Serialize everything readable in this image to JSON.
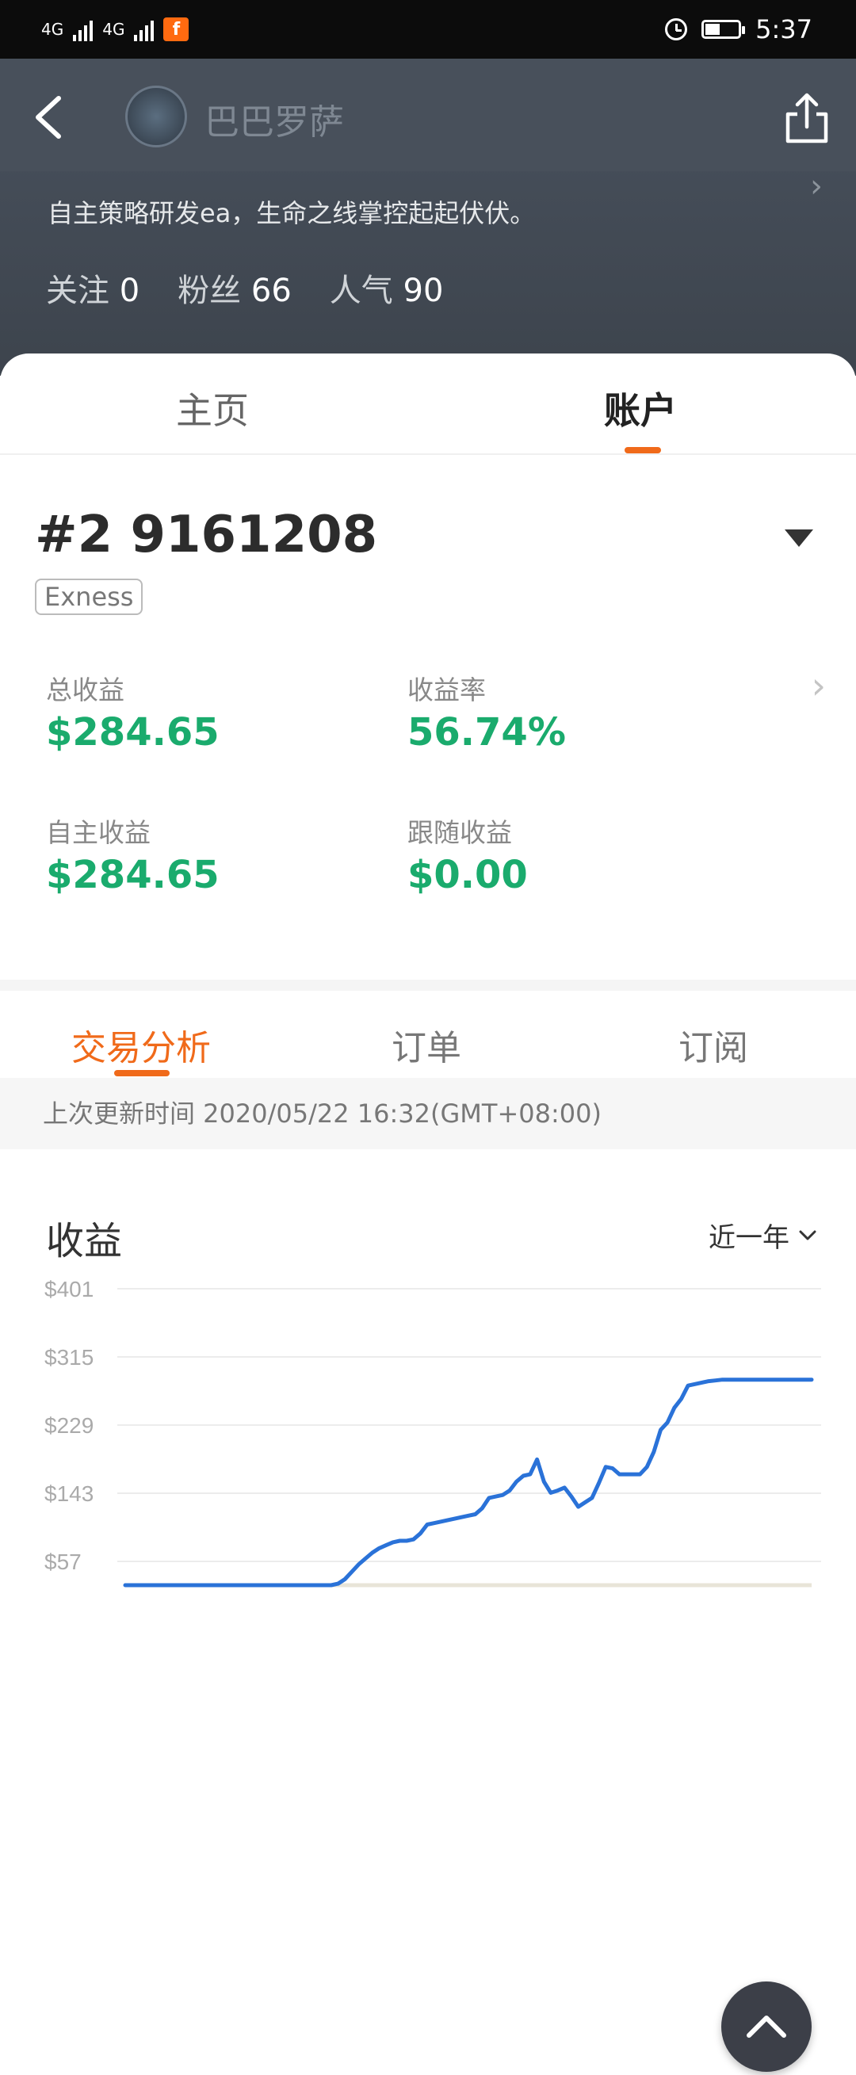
{
  "status_bar": {
    "network_1": "4G",
    "network_2": "4G",
    "time": "5:37"
  },
  "header": {
    "username": "巴巴罗萨",
    "bio": "自主策略研发ea，生命之线掌控起起伏伏。",
    "stats": [
      {
        "label": "关注",
        "value": "0"
      },
      {
        "label": "粉丝",
        "value": "66"
      },
      {
        "label": "人气",
        "value": "90"
      }
    ]
  },
  "tabs": {
    "home": "主页",
    "account": "账户"
  },
  "account": {
    "number": "#2 9161208",
    "broker": "Exness",
    "metrics": [
      {
        "label": "总收益",
        "value": "$284.65"
      },
      {
        "label": "收益率",
        "value": "56.74%"
      },
      {
        "label": "自主收益",
        "value": "$284.65"
      },
      {
        "label": "跟随收益",
        "value": "$0.00"
      }
    ]
  },
  "sub_tabs": {
    "analysis": "交易分析",
    "orders": "订单",
    "subscriptions": "订阅"
  },
  "update_time": "上次更新时间 2020/05/22 16:32(GMT+08:00)",
  "section": {
    "title": "收益",
    "range": "近一年"
  },
  "colors": {
    "accent": "#f06a1a",
    "positive": "#1aab6d",
    "line": "#2a72d8"
  },
  "chart_data": {
    "type": "line",
    "title": "",
    "xlabel": "",
    "ylabel": "",
    "y_ticks": [
      "$401",
      "$315",
      "$229",
      "$143",
      "$57"
    ],
    "ylim": [
      0,
      401
    ],
    "x": [
      0,
      1,
      2,
      3,
      4,
      5,
      6,
      7,
      8,
      9,
      10,
      11,
      12,
      13,
      14,
      15,
      16,
      17,
      18,
      19,
      20,
      21,
      22,
      23,
      24,
      25,
      26,
      27,
      28,
      29,
      30,
      31,
      32,
      33,
      34,
      35,
      36,
      37,
      38,
      39,
      40,
      41,
      42,
      43,
      44,
      45,
      46,
      47,
      48,
      49,
      50,
      51,
      52,
      53,
      54,
      55,
      56,
      57,
      58,
      59,
      60,
      61,
      62,
      63,
      64,
      65,
      66,
      67,
      68,
      69,
      70,
      71,
      72,
      73,
      74,
      75,
      76,
      77,
      78,
      79,
      80,
      81,
      82,
      83,
      84,
      85,
      86,
      87,
      88,
      89,
      90,
      91,
      92,
      93,
      94,
      95,
      96,
      97,
      98,
      99,
      100
    ],
    "series": [
      {
        "values": [
          0,
          0,
          0,
          0,
          0,
          0,
          0,
          0,
          0,
          0,
          0,
          0,
          0,
          0,
          0,
          0,
          0,
          0,
          0,
          0,
          0,
          0,
          0,
          0,
          0,
          0,
          0,
          0,
          0,
          0,
          0,
          2,
          8,
          18,
          28,
          36,
          44,
          50,
          54,
          58,
          60,
          60,
          62,
          70,
          82,
          84,
          86,
          88,
          90,
          92,
          94,
          96,
          104,
          118,
          120,
          122,
          128,
          140,
          148,
          150,
          170,
          140,
          125,
          128,
          132,
          120,
          106,
          112,
          118,
          138,
          160,
          158,
          150,
          150,
          150,
          150,
          160,
          180,
          210,
          220,
          240,
          252,
          270,
          272,
          274,
          276,
          277,
          278,
          278,
          278,
          278,
          278,
          278,
          278,
          278,
          278,
          278,
          278,
          278,
          278,
          278
        ]
      }
    ]
  }
}
